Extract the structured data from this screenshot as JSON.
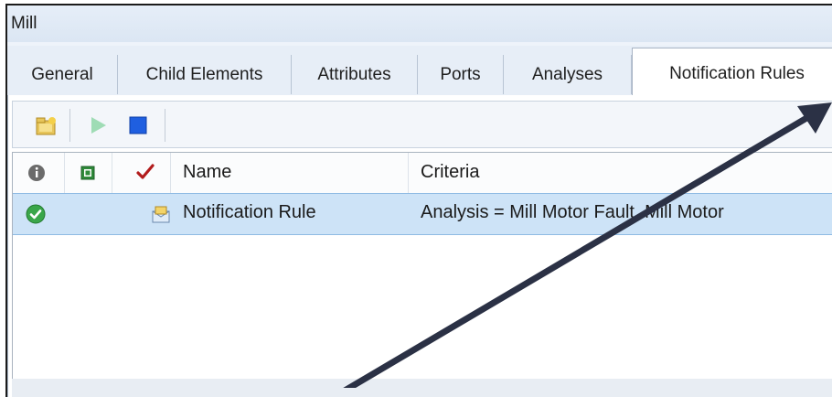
{
  "window": {
    "title": "Mill"
  },
  "tabs": [
    {
      "label": "General"
    },
    {
      "label": "Child Elements"
    },
    {
      "label": "Attributes"
    },
    {
      "label": "Ports"
    },
    {
      "label": "Analyses"
    },
    {
      "label": "Notification Rules"
    }
  ],
  "active_tab": "Notification Rules",
  "toolbar": {
    "buttons": [
      {
        "icon": "new-folder-icon"
      },
      {
        "icon": "play-icon"
      },
      {
        "icon": "stop-icon"
      }
    ]
  },
  "grid": {
    "columns": {
      "info_icon": "info-icon",
      "status_icon": "status-icon",
      "check_icon": "checkmark-icon",
      "name": "Name",
      "criteria": "Criteria"
    },
    "rows": [
      {
        "status_icon": "green-check-icon",
        "type_icon": "notification-rule-icon",
        "name": "Notification Rule",
        "criteria": "Analysis = Mill Motor Fault, Mill Motor"
      }
    ]
  },
  "colors": {
    "selected_row": "#cde3f7",
    "play_disabled": "#9fdcb5",
    "stop": "#1f5fe0",
    "arrow": "#2b3145"
  }
}
